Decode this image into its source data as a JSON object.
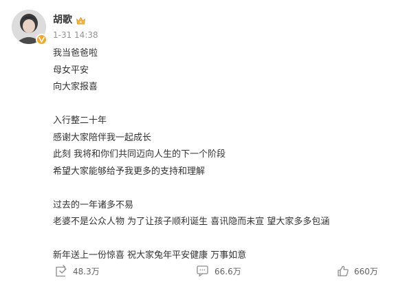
{
  "post": {
    "author": {
      "name": "胡歌",
      "avatar_icon": "avatar-photo",
      "verified_badge_icon": "verified-v-icon",
      "badge_color": "#f5a623",
      "member_icon": "crown-icon"
    },
    "timestamp": "1-31 14:38",
    "lines": [
      "我当爸爸啦",
      "母女平安",
      "向大家报喜",
      "",
      "入行整二十年",
      "感谢大家陪伴我一起成长",
      "此刻 我将和你们共同迈向人生的下一个阶段",
      "希望大家能够给予我更多的支持和理解",
      "",
      "过去的一年诸多不易",
      "老婆不是公众人物 为了让孩子顺利诞生 喜讯隐而未宣 望大家多多包涵",
      "",
      "新年送上一份惊喜 祝大家兔年平安健康 万事如意"
    ],
    "actions": {
      "repost": {
        "icon": "repost-icon",
        "count": "48.3万"
      },
      "comment": {
        "icon": "comment-icon",
        "count": "66.6万"
      },
      "like": {
        "icon": "thumbs-up-icon",
        "count": "660万"
      }
    }
  }
}
